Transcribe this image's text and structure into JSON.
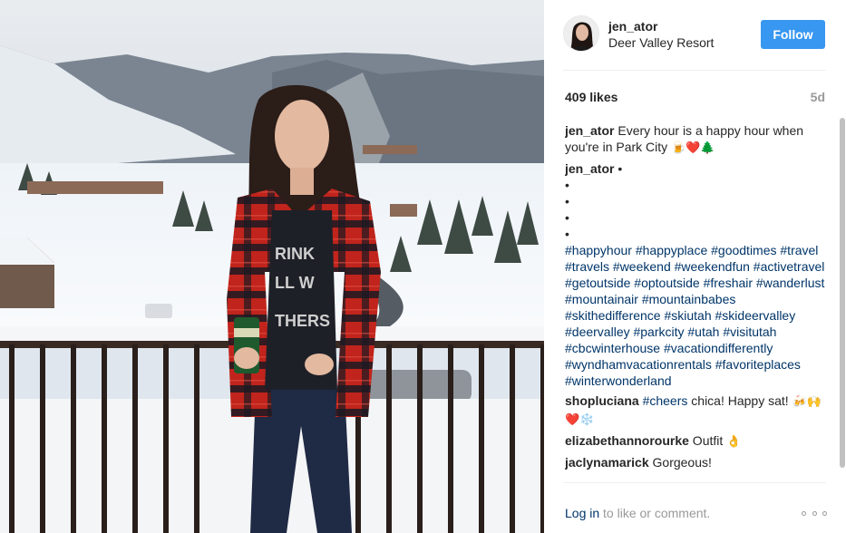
{
  "post": {
    "username": "jen_ator",
    "location": "Deer Valley Resort",
    "follow_label": "Follow",
    "likes": "409 likes",
    "age": "5d",
    "photo_shirt_text": [
      "RINK",
      "LL W",
      "THERS"
    ]
  },
  "comments": [
    {
      "user": "jen_ator",
      "text": " Every hour is a happy hour when you're in Park City ",
      "emoji": "🍺❤️🌲"
    },
    {
      "user": "jen_ator",
      "text": " •",
      "dots": [
        "•",
        "•",
        "•",
        "•"
      ],
      "hashtags": "#happyhour #happyplace #goodtimes #travel #travels #weekend #weekendfun #activetravel #getoutside #optoutside #freshair #wanderlust #mountainair #mountainbabes #skithedifference #skiutah #skideervalley #deervalley #parkcity #utah #visitutah #cbcwinterhouse #vacationdifferently #wyndhamvacationrentals #favoriteplaces #winterwonderland"
    },
    {
      "user": "shopluciana",
      "tag": "#cheers",
      "text": " chica! Happy sat! ",
      "emoji": "🍻🙌❤️❄️"
    },
    {
      "user": "elizabethannorourke",
      "text": " Outfit ",
      "emoji": "👌"
    },
    {
      "user": "jaclynamarick",
      "text": " Gorgeous!"
    }
  ],
  "footer": {
    "login_label": "Log in",
    "login_suffix": " to like or comment."
  },
  "icons": {
    "more": "more-options-icon"
  },
  "colors": {
    "follow_bg": "#3897f0",
    "link": "#003569",
    "muted": "#999999"
  }
}
